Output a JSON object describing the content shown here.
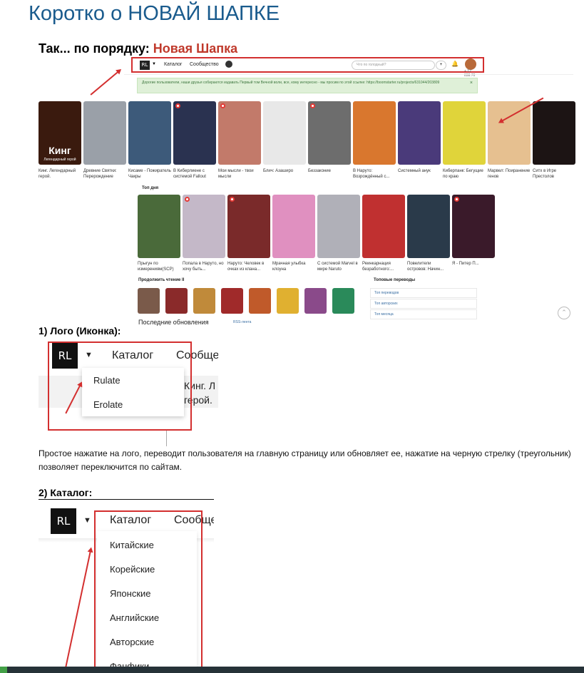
{
  "page_title": "Коротко о НОВАЙ ШАПКЕ",
  "intro": {
    "prefix": "Так... по порядку:",
    "accent": "Новая Шапка"
  },
  "mini_header": {
    "logo": "RL",
    "nav": [
      "Каталог",
      "Сообщество"
    ],
    "search_placeholder": "Что по голодный?",
    "balance": "+ 12 838.70"
  },
  "alert": {
    "text": "Дорогие пользователи, наши друзья собираются издавать Первый том Вечной воли, все, кому интересно - мы просим по этой ссылке: https://boomstarter.ru/projects/631044/203809",
    "close": "×"
  },
  "books_row1": [
    {
      "title": "Кинг. Легендарный герой.",
      "overlay": "Кинг",
      "overlay_sub": "Легендарный герой",
      "color": "#3a1a0e"
    },
    {
      "title": "Древние Святки: Перерождение",
      "overlay": "",
      "overlay_sub": "",
      "color": "#9aa0a8"
    },
    {
      "title": "Кисаме - Пожиратель Чакры",
      "overlay": "",
      "overlay_sub": "",
      "color": "#3d5a7a"
    },
    {
      "title": "В Киберлиене с системой Fallout",
      "overlay": "",
      "overlay_sub": "",
      "color": "#2a3250"
    },
    {
      "title": "Мои мысли - твои мысли",
      "overlay": "",
      "overlay_sub": "",
      "color": "#c27a6a"
    },
    {
      "title": "Блич: Азаширо",
      "overlay": "",
      "overlay_sub": "",
      "color": "#e8e8e8"
    },
    {
      "title": "Беззаконие",
      "overlay": "",
      "overlay_sub": "",
      "color": "#6d6d6d"
    },
    {
      "title": "В Наруто: Возрождённый с...",
      "overlay": "",
      "overlay_sub": "",
      "color": "#d9772e"
    },
    {
      "title": "Системный анук",
      "overlay": "",
      "overlay_sub": "",
      "color": "#4a3a7a"
    },
    {
      "title": "Киберпанк: Бегущие по краю",
      "overlay": "",
      "overlay_sub": "",
      "color": "#e0d43a"
    },
    {
      "title": "Марвел: Поиранение генов",
      "overlay": "",
      "overlay_sub": "",
      "color": "#e6c090"
    },
    {
      "title": "Ситх в Игре Престолов",
      "overlay": "",
      "overlay_sub": "",
      "color": "#1c1414"
    }
  ],
  "top_day": {
    "heading": "Топ дня",
    "books": [
      {
        "title": "Прыгун по измерениям(SCP)",
        "color": "#4a6a3a"
      },
      {
        "title": "Попала в Наруто, но хочу быть...",
        "color": "#c4b8c8"
      },
      {
        "title": "Наруто: Человек в очках из клана...",
        "color": "#7a2a2a"
      },
      {
        "title": "Мрачная улыбка клоуна",
        "color": "#e090c0"
      },
      {
        "title": "С системой Marvel в мире Naruto",
        "color": "#b0b0b8"
      },
      {
        "title": "Реинкарнация безработного:...",
        "color": "#c03030"
      },
      {
        "title": "Повелители островов: Начин...",
        "color": "#2a3a4a"
      },
      {
        "title": "Я - Питер П...",
        "color": "#3a1a2a"
      }
    ]
  },
  "continue_reading": {
    "heading": "Продолжить чтение II",
    "thumb_colors": [
      "#7a5a4a",
      "#8a2a2a",
      "#c08a3a",
      "#a02a2a",
      "#c05a2a",
      "#e0b030",
      "#8a4a8a",
      "#2a8a5a"
    ]
  },
  "top_translations": {
    "heading": "Топовые переводы",
    "items": [
      "Топ переводов",
      "Топ авторских",
      "Топ месяца"
    ]
  },
  "latest_updates": {
    "heading": "Последние обновления",
    "link": "RSS-лента"
  },
  "section1": {
    "heading": "1) Лого (Иконка):",
    "logo": "RL",
    "caret": "▼",
    "nav": [
      "Каталог",
      "Сообщест"
    ],
    "dropdown": [
      "Rulate",
      "Erolate"
    ],
    "behind": [
      "Кинг. Л",
      "герой."
    ]
  },
  "paragraph": "Простое нажатие на лого, переводит пользователя на главную страницу или обновляет ее, нажатие на черную стрелку (треугольник) позволяет переключится по сайтам.",
  "section2": {
    "heading": "2) Каталог:",
    "logo": "RL",
    "caret": "▼",
    "nav": [
      "Каталог",
      "Сообщест"
    ],
    "dropdown": [
      "Китайские",
      "Корейские",
      "Японские",
      "Английские",
      "Авторские",
      "Фанфики"
    ]
  },
  "colors": {
    "title": "#1a5b8d",
    "accent": "#c0392b",
    "highlight": "#d32f2f"
  }
}
